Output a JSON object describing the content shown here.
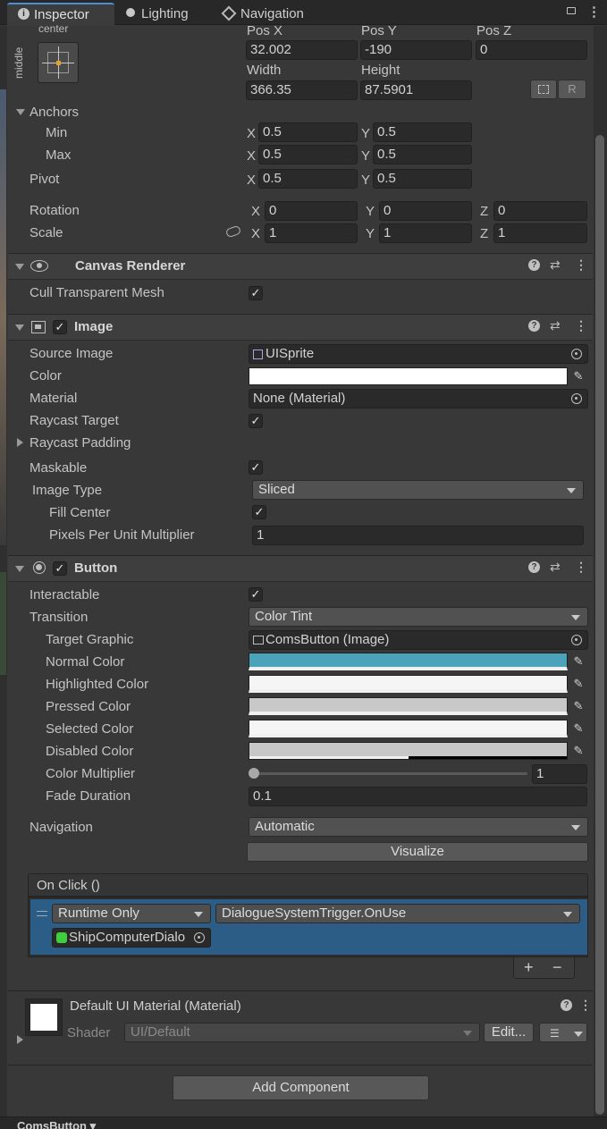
{
  "tabs": [
    {
      "label": "Inspector",
      "icon": "info-icon",
      "active": true
    },
    {
      "label": "Lighting",
      "icon": "lightbulb-icon",
      "active": false
    },
    {
      "label": "Navigation",
      "icon": "navigation-icon",
      "active": false
    }
  ],
  "rect_transform": {
    "anchor_preset_top": "center",
    "anchor_preset_side": "middle",
    "pos_x_label": "Pos X",
    "pos_y_label": "Pos Y",
    "pos_z_label": "Pos Z",
    "pos_x": "32.002",
    "pos_y": "-190",
    "pos_z": "0",
    "width_label": "Width",
    "height_label": "Height",
    "width": "366.35",
    "height": "87.5901",
    "raw_edit_button": "R",
    "anchors_label": "Anchors",
    "min_label": "Min",
    "max_label": "Max",
    "anchor_min_x": "0.5",
    "anchor_min_y": "0.5",
    "anchor_max_x": "0.5",
    "anchor_max_y": "0.5",
    "pivot_label": "Pivot",
    "pivot_x": "0.5",
    "pivot_y": "0.5",
    "rotation_label": "Rotation",
    "rot_x": "0",
    "rot_y": "0",
    "rot_z": "0",
    "scale_label": "Scale",
    "scale_x": "1",
    "scale_y": "1",
    "scale_z": "1",
    "x": "X",
    "y": "Y",
    "z": "Z"
  },
  "canvas_renderer": {
    "title": "Canvas Renderer",
    "cull_label": "Cull Transparent Mesh",
    "cull_checked": true
  },
  "image": {
    "title": "Image",
    "source_image_label": "Source Image",
    "source_image": "UISprite",
    "color_label": "Color",
    "color": "#ffffff",
    "material_label": "Material",
    "material": "None (Material)",
    "raycast_target_label": "Raycast Target",
    "raycast_padding_label": "Raycast Padding",
    "maskable_label": "Maskable",
    "image_type_label": "Image Type",
    "image_type": "Sliced",
    "fill_center_label": "Fill Center",
    "ppu_label": "Pixels Per Unit Multiplier",
    "ppu": "1"
  },
  "button": {
    "title": "Button",
    "interactable_label": "Interactable",
    "transition_label": "Transition",
    "transition": "Color Tint",
    "target_graphic_label": "Target Graphic",
    "target_graphic": "ComsButton (Image)",
    "normal_label": "Normal Color",
    "normal_color": "#4aa3b8",
    "highlighted_label": "Highlighted Color",
    "highlighted_color": "#f5f5f5",
    "pressed_label": "Pressed Color",
    "pressed_color": "#c8c8c8",
    "selected_label": "Selected Color",
    "selected_color": "#f5f5f5",
    "disabled_label": "Disabled Color",
    "disabled_color": "#c8c8c8",
    "multiplier_label": "Color Multiplier",
    "multiplier": "1",
    "fade_label": "Fade Duration",
    "fade": "0.1",
    "navigation_label": "Navigation",
    "navigation": "Automatic",
    "visualize_label": "Visualize",
    "on_click_label": "On Click ()",
    "runtime": "Runtime Only",
    "function": "DialogueSystemTrigger.OnUse",
    "object": "ShipComputerDialo",
    "add": "+",
    "remove": "−"
  },
  "material": {
    "title": "Default UI Material (Material)",
    "shader_label": "Shader",
    "shader": "UI/Default",
    "edit_label": "Edit..."
  },
  "add_component_label": "Add Component",
  "bottom_tab": "ComsButton ▾"
}
